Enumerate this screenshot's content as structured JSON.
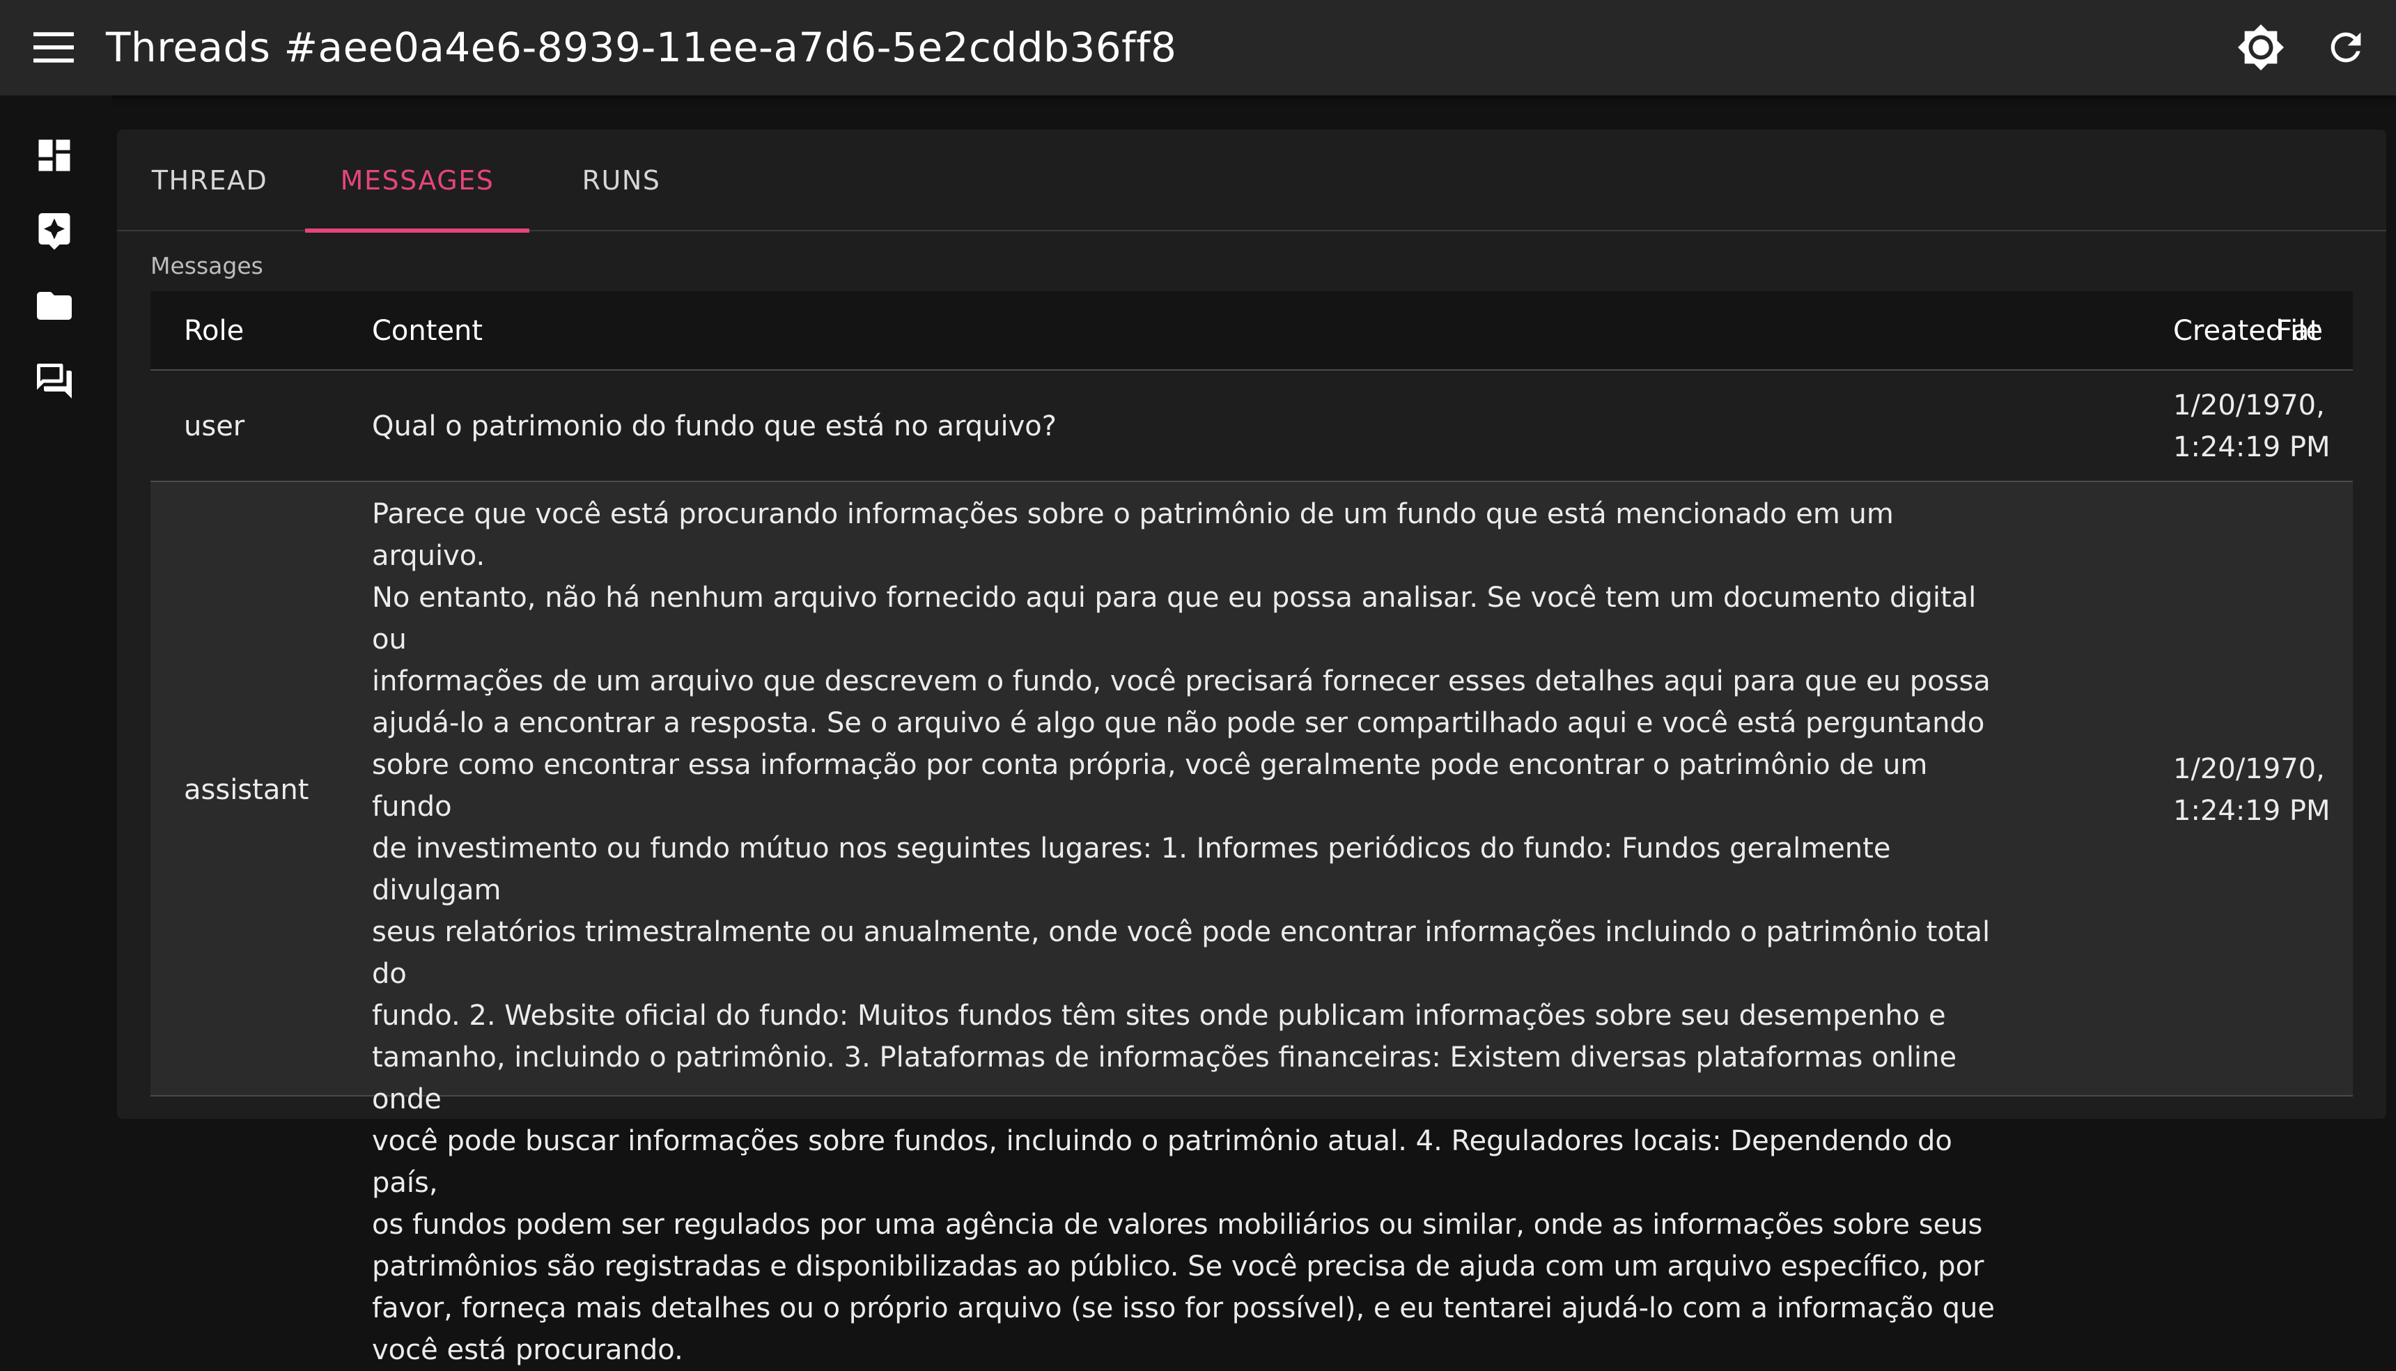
{
  "appbar": {
    "title": "Threads #aee0a4e6-8939-11ee-a7d6-5e2cddb36ff8",
    "menu_icon": "menu-icon",
    "theme_icon": "brightness-icon",
    "refresh_icon": "refresh-icon"
  },
  "sidebar": {
    "items": [
      {
        "icon": "dashboard-icon"
      },
      {
        "icon": "assistant-icon"
      },
      {
        "icon": "folder-icon"
      },
      {
        "icon": "forum-icon"
      }
    ]
  },
  "tabs": [
    {
      "label": "THREAD",
      "active": false
    },
    {
      "label": "MESSAGES",
      "active": true
    },
    {
      "label": "RUNS",
      "active": false
    }
  ],
  "messages": {
    "section_label": "Messages",
    "columns": [
      "Role",
      "Content",
      "Created at",
      "File"
    ],
    "rows": [
      {
        "role": "user",
        "content": "Qual o patrimonio do fundo que está no arquivo?",
        "created_at_line1": "1/20/1970,",
        "created_at_line2": "1:24:19 PM",
        "file": ""
      },
      {
        "role": "assistant",
        "content_lines": [
          "Parece que você está procurando informações sobre o patrimônio de um fundo que está mencionado em um arquivo.",
          "No entanto, não há nenhum arquivo fornecido aqui para que eu possa analisar. Se você tem um documento digital ou",
          "informações de um arquivo que descrevem o fundo, você precisará fornecer esses detalhes aqui para que eu possa",
          "ajudá-lo a encontrar a resposta. Se o arquivo é algo que não pode ser compartilhado aqui e você está perguntando",
          "sobre como encontrar essa informação por conta própria, você geralmente pode encontrar o patrimônio de um fundo",
          "de investimento ou fundo mútuo nos seguintes lugares: 1. Informes periódicos do fundo: Fundos geralmente divulgam",
          "seus relatórios trimestralmente ou anualmente, onde você pode encontrar informações incluindo o patrimônio total do",
          "fundo. 2. Website oficial do fundo: Muitos fundos têm sites onde publicam informações sobre seu desempenho e",
          "tamanho, incluindo o patrimônio. 3. Plataformas de informações financeiras: Existem diversas plataformas online onde",
          "você pode buscar informações sobre fundos, incluindo o patrimônio atual. 4. Reguladores locais: Dependendo do país,",
          "os fundos podem ser regulados por uma agência de valores mobiliários ou similar, onde as informações sobre seus",
          "patrimônios são registradas e disponibilizadas ao público. Se você precisa de ajuda com um arquivo específico, por",
          "favor, forneça mais detalhes ou o próprio arquivo (se isso for possível), e eu tentarei ajudá-lo com a informação que",
          "você está procurando."
        ],
        "created_at_line1": "1/20/1970,",
        "created_at_line2": "1:24:19 PM",
        "file": ""
      }
    ]
  },
  "colors": {
    "accent": "#e5457a",
    "appbar": "#272727",
    "background": "#121212",
    "panel": "#1e1e1e"
  }
}
